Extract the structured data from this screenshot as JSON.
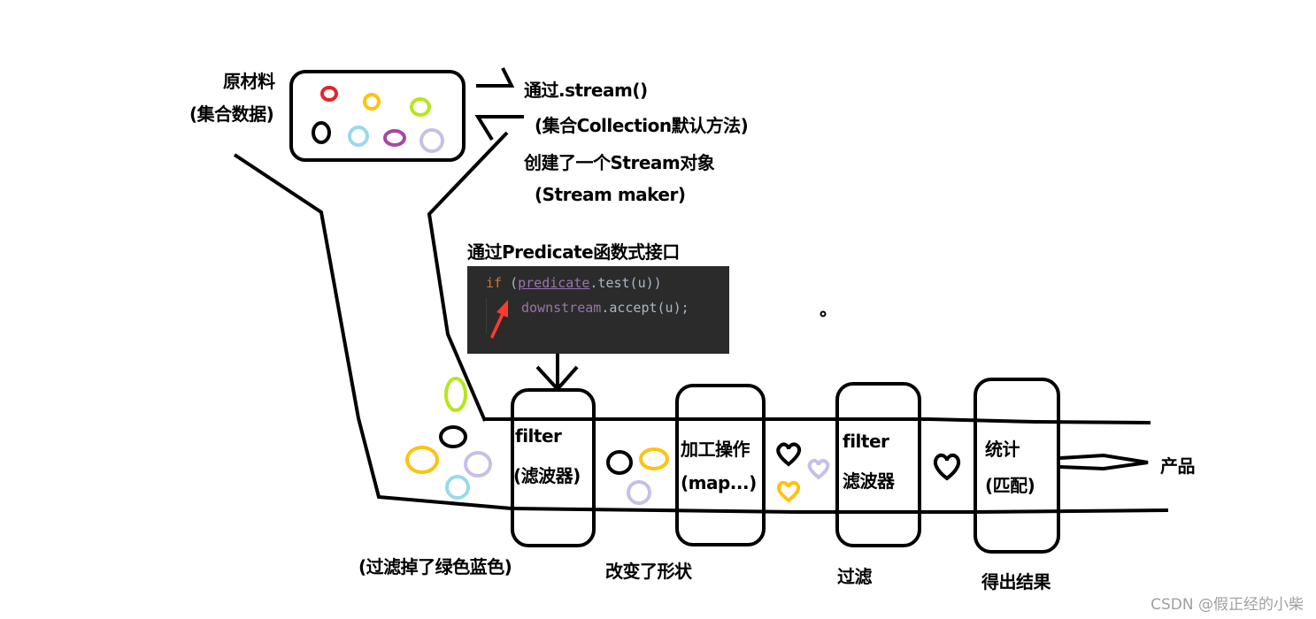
{
  "raw_material": {
    "title": "原材料",
    "subtitle": "(集合数据)"
  },
  "stream_creation": {
    "line1": "通过.stream()",
    "line2": "(集合Collection默认方法)",
    "line3": "创建了一个Stream对象",
    "line4": "(Stream maker)"
  },
  "predicate": {
    "heading": "通过Predicate函数式接口",
    "code_line1": {
      "kw": "if",
      "open": " (",
      "var": "predicate",
      "rest": ".test(u))"
    },
    "code_line2": {
      "var": "downstream",
      "rest": ".accept(u);"
    }
  },
  "stages": [
    {
      "line1": "filter",
      "line2": "(滤波器)",
      "caption": "(过滤掉了绿色蓝色)"
    },
    {
      "line1": "加工操作",
      "line2": "(map...)",
      "caption": "改变了形状"
    },
    {
      "line1": "filter",
      "line2": "滤波器",
      "caption": "过滤"
    },
    {
      "line1": "统计",
      "line2": "(匹配)",
      "caption": "得出结果"
    }
  ],
  "output": {
    "label": "产品"
  },
  "colors": {
    "red": "#e8212b",
    "yellow": "#ffc20e",
    "green": "#b5e61d",
    "black": "#000000",
    "lightblue": "#99d9ea",
    "purple": "#a349a4",
    "lavender": "#c8bfe7",
    "code_bg": "#2b2b2b",
    "arrow_red": "#ff3b30"
  },
  "watermark": "CSDN @假正经的小柴"
}
